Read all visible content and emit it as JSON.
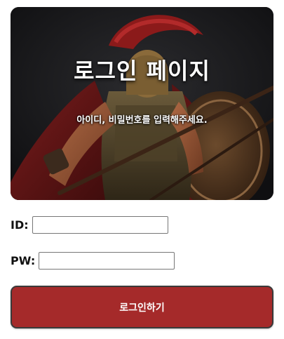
{
  "hero": {
    "title": "로그인 페이지",
    "subtitle": "아이디, 비밀번호를 입력해주세요."
  },
  "form": {
    "id_label": "ID:",
    "id_value": "",
    "pw_label": "PW:",
    "pw_value": "",
    "submit_label": "로그인하기"
  },
  "colors": {
    "button_bg": "#a52a2a",
    "button_border": "#3a3a3a",
    "hero_bg": "#1a1a1c"
  }
}
